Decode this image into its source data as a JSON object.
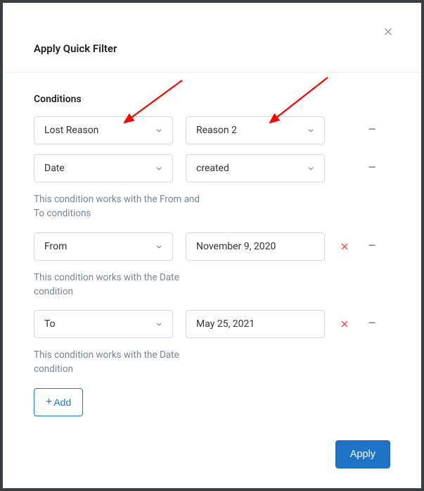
{
  "title": "Apply Quick Filter",
  "sectionLabel": "Conditions",
  "rows": {
    "r1": {
      "field": "Lost Reason",
      "value": "Reason 2"
    },
    "r2": {
      "field": "Date",
      "value": "created"
    },
    "r3": {
      "field": "From",
      "value": "November 9, 2020"
    },
    "r4": {
      "field": "To",
      "value": "May 25, 2021"
    }
  },
  "help": {
    "fromTo": "This condition works with the From and To conditions",
    "date1": "This condition works with the Date condition",
    "date2": "This condition works with the Date condition"
  },
  "buttons": {
    "add": "Add",
    "apply": "Apply"
  }
}
